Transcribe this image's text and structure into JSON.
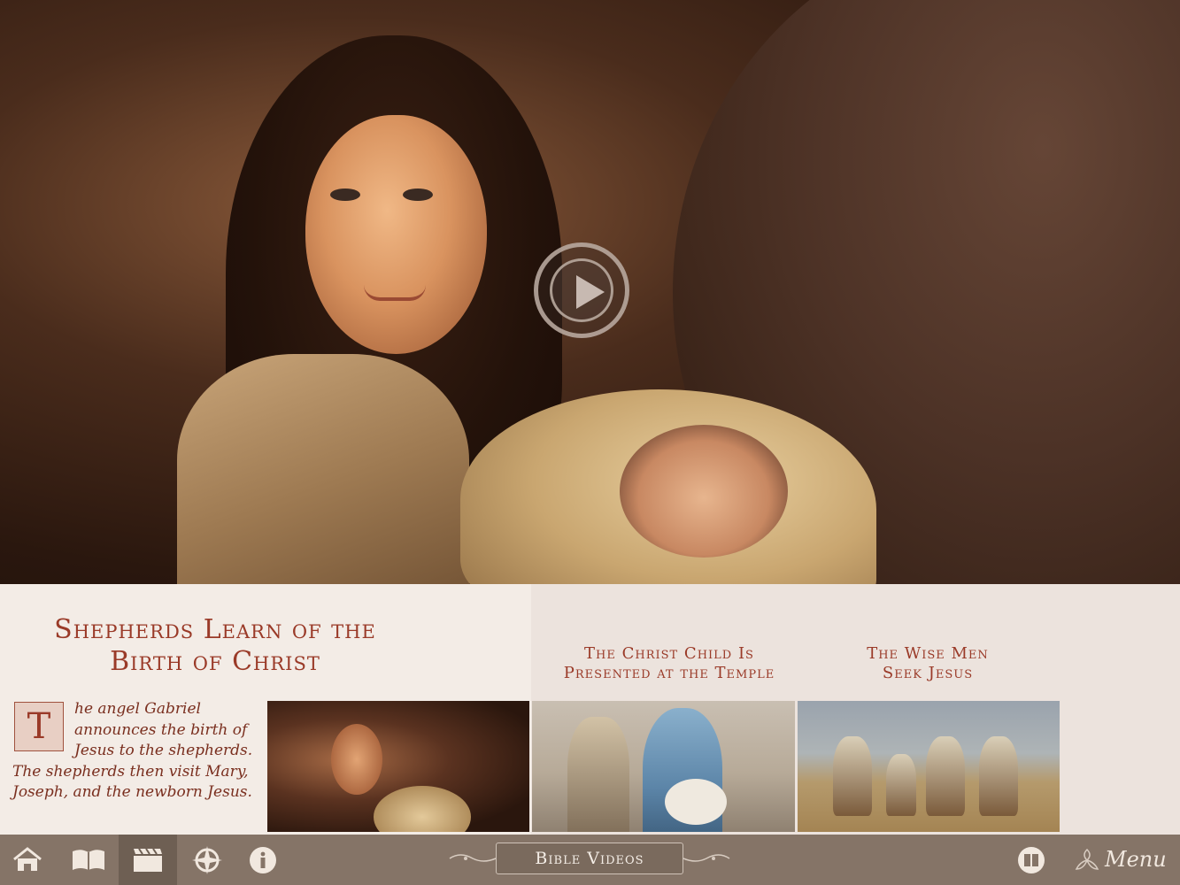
{
  "hero": {
    "play_icon": "play-icon"
  },
  "current": {
    "title_line1": "Shepherds Learn of the",
    "title_line2": "Birth of Christ",
    "drop_cap": "T",
    "desc_lines": [
      "he angel Gabriel",
      "announces the birth of",
      "Jesus to the shepherds.",
      "The shepherds then visit Mary,",
      "Joseph, and the newborn Jesus."
    ]
  },
  "related": [
    {
      "line1": "The Christ Child Is",
      "line2": "Presented at the Temple"
    },
    {
      "line1": "The Wise Men",
      "line2": "Seek Jesus"
    }
  ],
  "toolbar": {
    "center_label": "Bible Videos",
    "menu_label": "Menu",
    "icons": [
      "home-icon",
      "book-icon",
      "video-clapper-icon",
      "compass-icon",
      "info-icon",
      "bible-icon",
      "menu-ornament-icon"
    ]
  },
  "colors": {
    "title": "#9a3a28",
    "toolbar": "#857467",
    "panel_left": "#f3ece6",
    "panel_right": "#ece3dd"
  }
}
